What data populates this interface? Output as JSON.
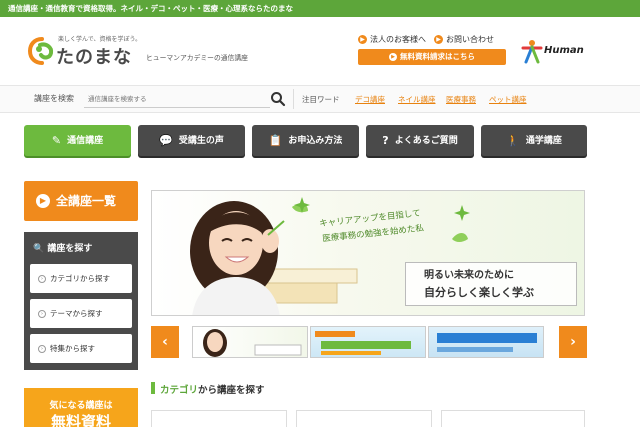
{
  "topbar": {
    "text": "通信講座・通信教育で資格取得。ネイル・デコ・ペット・医療・心理系ならたのまな"
  },
  "brand": {
    "tagline": "楽しく学んで、資格を学ぼう。",
    "name": "たのまな",
    "subtitle": "ヒューマンアカデミーの通信講座",
    "partner_logo": "Human"
  },
  "header_links": {
    "corporate": "法人のお客様へ",
    "contact": "お問い合わせ",
    "request": "無料資料請求はこちら"
  },
  "search": {
    "label": "講座を検索",
    "placeholder": "通信講座を検索する",
    "keyword_label": "注目ワード",
    "keywords": [
      "デコ講座",
      "ネイル講座",
      "医療事務",
      "ペット講座"
    ]
  },
  "nav": {
    "items": [
      {
        "label": "通信講座"
      },
      {
        "label": "受講生の声"
      },
      {
        "label": "お申込み方法"
      },
      {
        "label": "よくあるご質問"
      },
      {
        "label": "通学講座"
      }
    ]
  },
  "sidebar": {
    "all_courses": "全講座一覧",
    "find_title": "講座を探す",
    "find_items": [
      "カテゴリから探す",
      "テーマから探す",
      "特集から探す"
    ],
    "promo_line1": "気になる講座は",
    "promo_line2": "無料資料"
  },
  "hero": {
    "handwritten_1": "キャリアアップを目指して",
    "handwritten_2": "医療事務の勉強を始めた私",
    "catch_1": "明るい未来のために",
    "catch_2": "自分らしく楽しく学ぶ"
  },
  "section": {
    "title_highlight": "カテゴリ",
    "title_rest": "から講座を探す"
  },
  "colors": {
    "brand_green": "#6dba3e",
    "accent_orange": "#f08a1c",
    "nav_dark": "#4a4a4a"
  }
}
